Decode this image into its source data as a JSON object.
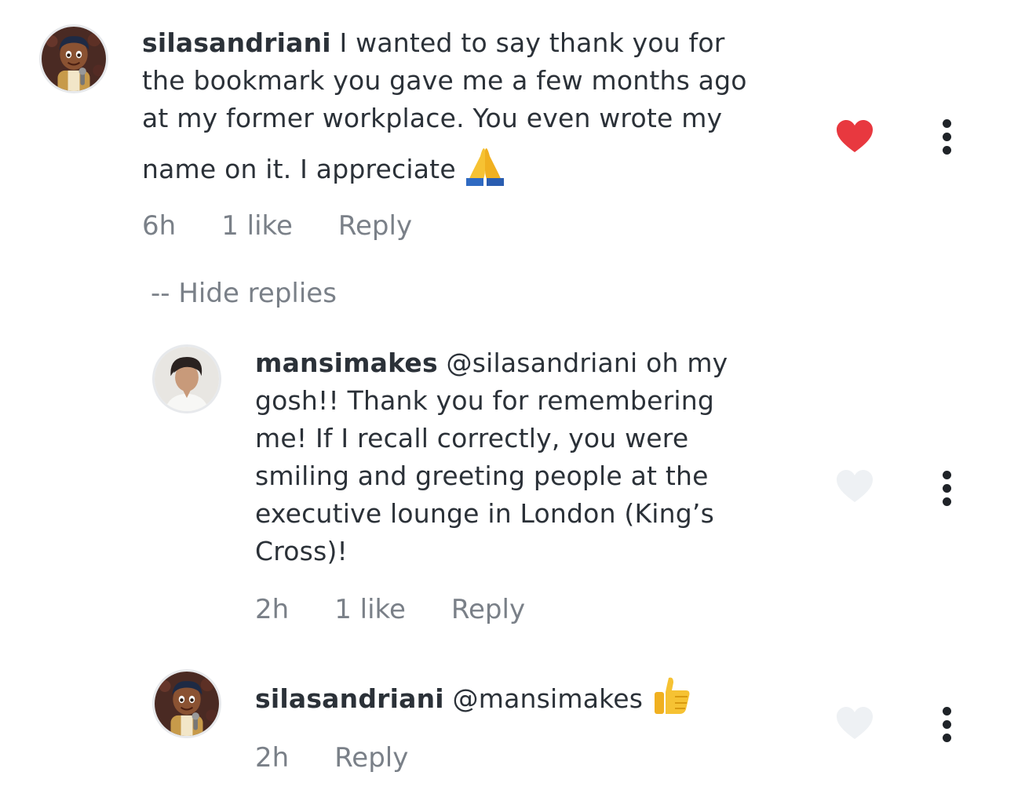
{
  "comments": [
    {
      "username": "silasandriani",
      "body": "I wanted to say thank you for the bookmark you gave me a few months ago at my former workplace. You even wrote my name on it. I appreciate",
      "lines": [
        "I wanted to say thank you for",
        "the bookmark you gave me a few months ago",
        "at my former workplace. You even wrote my",
        "name on it. I appreciate"
      ],
      "emoji": "folded-hands",
      "time": "6h",
      "likes": "1 like",
      "reply": "Reply",
      "liked": true,
      "heart_color": "#e8383f"
    },
    {
      "username": "mansimakes",
      "mention": "@silasandriani",
      "lines": [
        "oh my",
        "gosh!! Thank you for remembering",
        "me! If I recall correctly, you were",
        "smiling and greeting people at the",
        "executive lounge in London (King’s",
        "Cross)!"
      ],
      "time": "2h",
      "likes": "1 like",
      "reply": "Reply",
      "liked": false
    },
    {
      "username": "silasandriani",
      "mention": "@mansimakes",
      "emoji": "thumbs-up",
      "time": "2h",
      "reply": "Reply",
      "liked": false
    }
  ],
  "hide_replies": "-- Hide replies",
  "colors": {
    "text": "#2b3138",
    "meta": "#7a8088",
    "heart_liked": "#e8383f",
    "heart_unliked": "#eef1f4",
    "more_dots": "#1f2328"
  },
  "icons": {
    "liked_heart": "heart-filled-icon",
    "unliked_heart": "heart-outline-icon",
    "more": "more-vertical-icon"
  }
}
